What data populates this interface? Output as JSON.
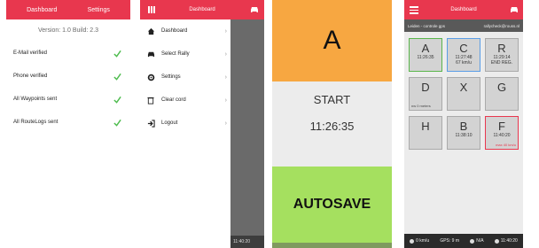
{
  "screen1": {
    "tabs": [
      "Dashboard",
      "Settings"
    ],
    "version": "Version: 1.0 Build: 2.3",
    "rows": [
      "E-Mail verified",
      "Phone verified",
      "All Waypoints sent",
      "All RouteLogs sent"
    ]
  },
  "screen2": {
    "title": "Dashboard",
    "menu": [
      "Dashboard",
      "Select Rally",
      "Settings",
      "Clear cord",
      "Logout"
    ],
    "bottom_text": "11:40:20"
  },
  "screen3": {
    "letter": "A",
    "start_label": "START",
    "time": "11:26:35",
    "autosave_label": "AUTOSAVE"
  },
  "screen4": {
    "title": "Dashboard",
    "sub_left": "Leiden - controle gps",
    "sub_right": "rallycheck@rouss.nl",
    "cells": [
      {
        "letter": "A",
        "lines": [
          "11:26:35"
        ],
        "corner": "",
        "corner_r": ""
      },
      {
        "letter": "C",
        "lines": [
          "11:27:48",
          "67 km/u"
        ],
        "corner": "",
        "corner_r": ""
      },
      {
        "letter": "R",
        "lines": [
          "11:29:14",
          "END REG."
        ],
        "corner": "",
        "corner_r": ""
      },
      {
        "letter": "D",
        "lines": [],
        "corner": "nw 0 meters",
        "corner_r": ""
      },
      {
        "letter": "X",
        "lines": [],
        "corner": "",
        "corner_r": ""
      },
      {
        "letter": "G",
        "lines": [],
        "corner": "",
        "corner_r": ""
      },
      {
        "letter": "H",
        "lines": [],
        "corner": "",
        "corner_r": ""
      },
      {
        "letter": "B",
        "lines": [
          "11:38:10"
        ],
        "corner": "",
        "corner_r": ""
      },
      {
        "letter": "F",
        "lines": [
          "11:40:20"
        ],
        "corner": "",
        "corner_r": "max 40 km/u"
      }
    ],
    "status": [
      "0 km/u",
      "GPS: 9 m",
      "N/A",
      "11:40:20"
    ]
  },
  "colors": {
    "red": "#e8374e",
    "orange": "#f7a741",
    "green": "#a5e05f",
    "check": "#4cbb4c"
  }
}
